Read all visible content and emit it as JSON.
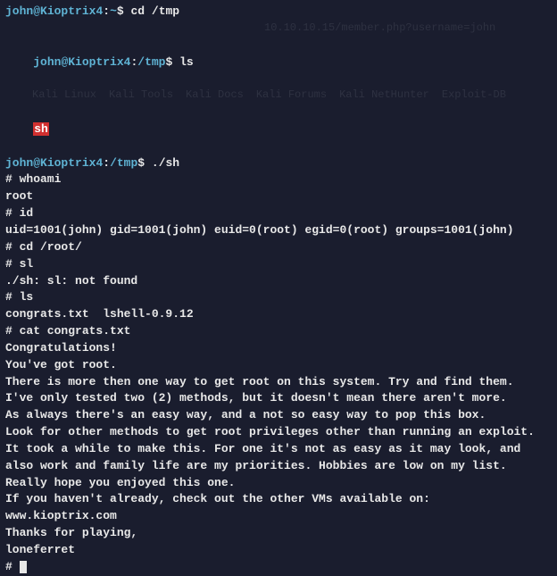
{
  "prompts": {
    "user": "john",
    "host": "Kioptrix4",
    "home_path": "~",
    "tmp_path": "/tmp",
    "dollar": "$"
  },
  "commands": {
    "cd_tmp": "cd /tmp",
    "ls": "ls",
    "run_sh": "./sh"
  },
  "bg_row": {
    "url_hint": "10.10.10.15/member.php?username=john",
    "items": [
      "Kali Linux",
      "Kali Tools",
      "Kali Docs",
      "Kali Forums",
      "Kali NetHunter",
      "Exploit-DB"
    ]
  },
  "sh_highlight": "sh",
  "output": {
    "l1": "# whoami",
    "l2": "root",
    "l3": "# id",
    "l4": "uid=1001(john) gid=1001(john) euid=0(root) egid=0(root) groups=1001(john)",
    "l5": "# cd /root/",
    "l6": "# sl",
    "l7": "./sh: sl: not found",
    "l8": "# ls",
    "l9": "congrats.txt  lshell-0.9.12",
    "l10": "# cat congrats.txt",
    "l11": "Congratulations!",
    "l12": "You've got root.",
    "l13": "",
    "l14": "There is more then one way to get root on this system. Try and find them.",
    "l15": "I've only tested two (2) methods, but it doesn't mean there aren't more.",
    "l16": "As always there's an easy way, and a not so easy way to pop this box.",
    "l17": "Look for other methods to get root privileges other than running an exploit.",
    "l18": "",
    "l19": "It took a while to make this. For one it's not as easy as it may look, and",
    "l20": "also work and family life are my priorities. Hobbies are low on my list.",
    "l21": "Really hope you enjoyed this one.",
    "l22": "",
    "l23": "If you haven't already, check out the other VMs available on:",
    "l24": "www.kioptrix.com",
    "l25": "",
    "l26": "Thanks for playing,",
    "l27": "loneferret",
    "l28": "",
    "l29": "# "
  }
}
